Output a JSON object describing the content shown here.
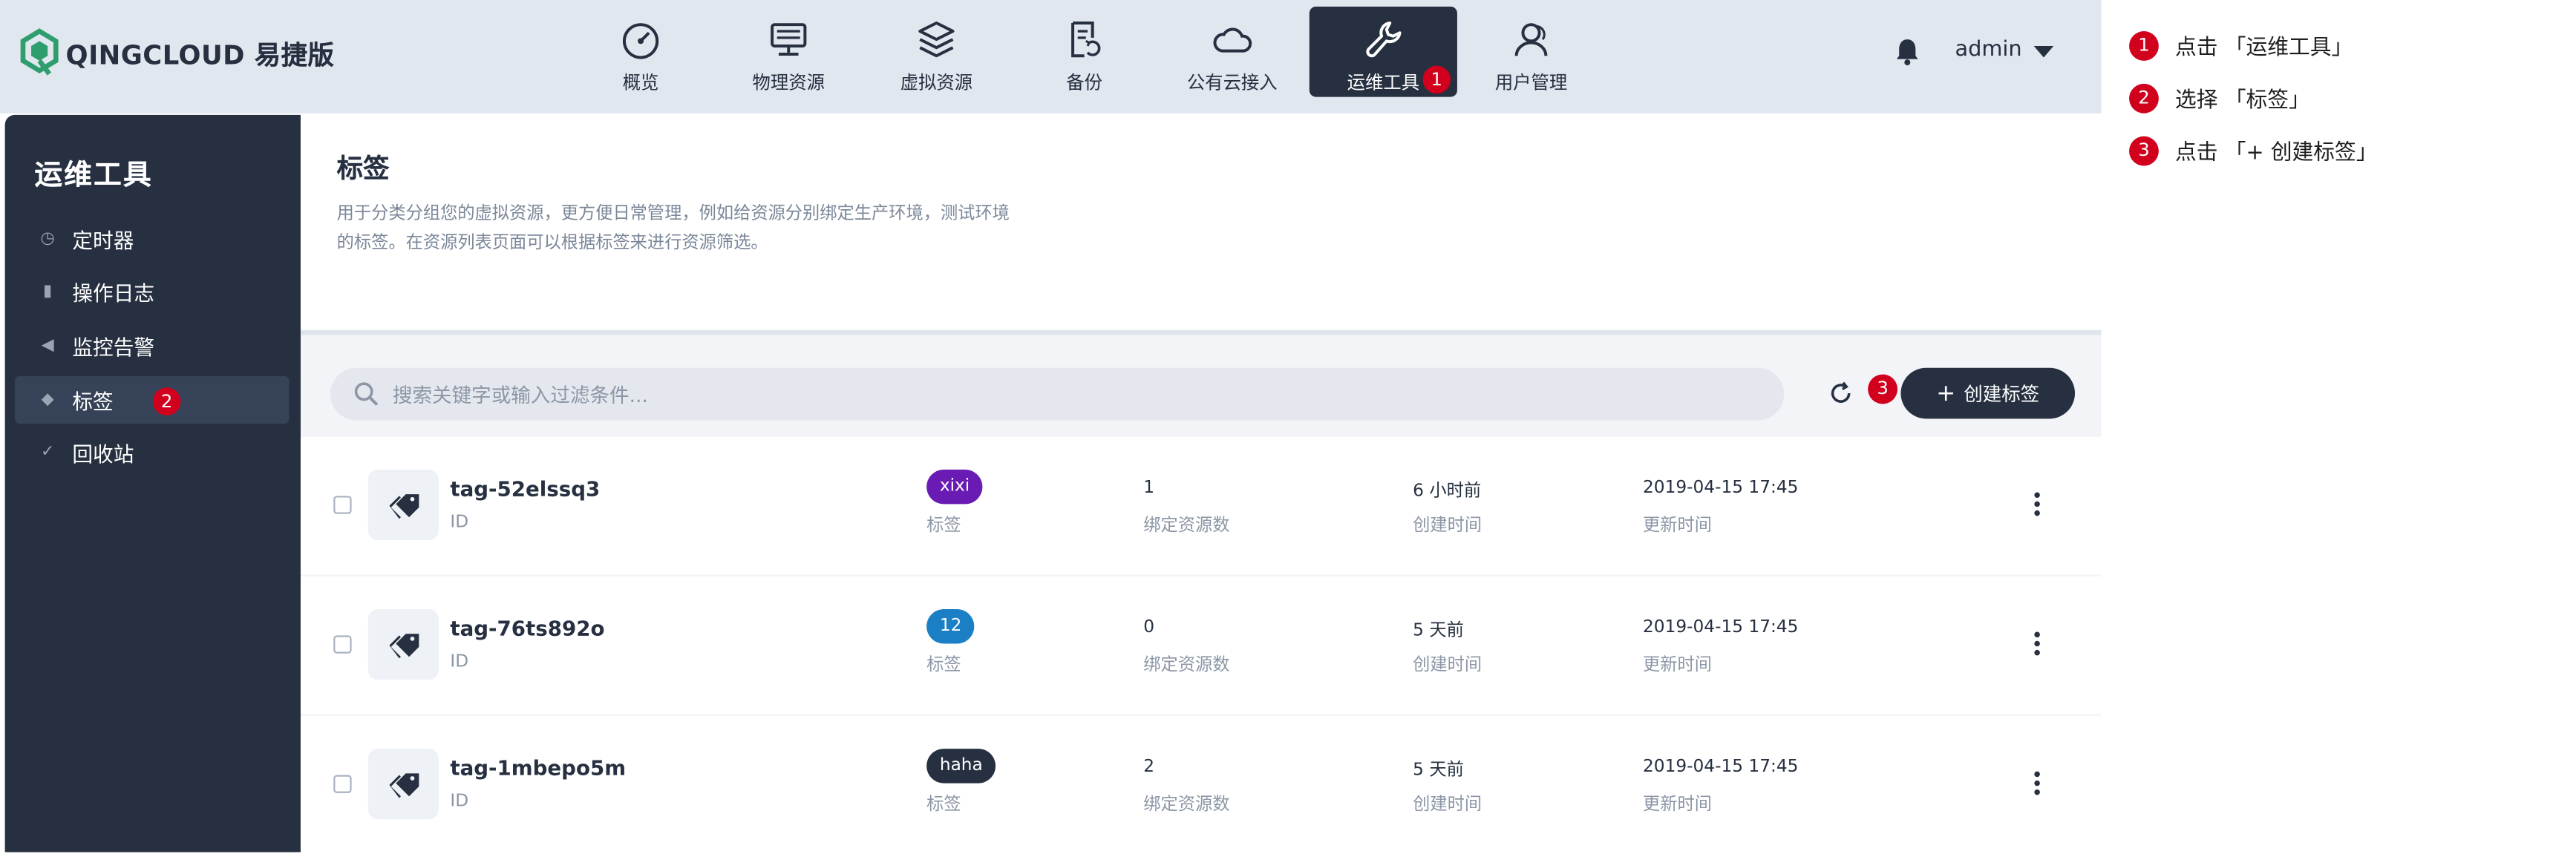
{
  "app": {
    "logo_text": "QINGCLOUD 易捷版",
    "brand_color": "#2f9e6e",
    "accent_dark": "#263040",
    "marker_color": "#d1001c"
  },
  "nav": {
    "items": [
      {
        "label": "概览",
        "icon": "dashboard-gauge-icon"
      },
      {
        "label": "物理资源",
        "icon": "server-icon"
      },
      {
        "label": "虚拟资源",
        "icon": "layers-icon"
      },
      {
        "label": "备份",
        "icon": "backup-document-icon"
      },
      {
        "label": "公有云接入",
        "icon": "cloud-icon"
      },
      {
        "label": "运维工具",
        "icon": "wrench-icon",
        "active": true,
        "marker": "1"
      },
      {
        "label": "用户管理",
        "icon": "users-icon"
      }
    ]
  },
  "user": {
    "name": "admin"
  },
  "sidebar": {
    "title": "运维工具",
    "items": [
      {
        "label": "定时器",
        "icon": "clock-icon"
      },
      {
        "label": "操作日志",
        "icon": "document-icon"
      },
      {
        "label": "监控告警",
        "icon": "megaphone-icon"
      },
      {
        "label": "标签",
        "icon": "tag-icon",
        "active": true,
        "marker": "2"
      },
      {
        "label": "回收站",
        "icon": "broom-icon"
      }
    ]
  },
  "page": {
    "title": "标签",
    "description": "用于分类分组您的虚拟资源，更方便日常管理，例如给资源分别绑定生产环境，测试环境的标签。在资源列表页面可以根据标签来进行资源筛选。"
  },
  "toolbar": {
    "search_placeholder": "搜索关键字或输入过滤条件...",
    "create_label": "创建标签",
    "create_plus": "+",
    "marker": "3"
  },
  "rows": [
    {
      "id": "tag-52elssq3",
      "id_label": "ID",
      "tag": "xixi",
      "tag_color": "#6a1bb3",
      "tag_label": "标签",
      "bound": "1",
      "bound_label": "绑定资源数",
      "created": "6 小时前",
      "created_label": "创建时间",
      "updated": "2019-04-15 17:45",
      "updated_label": "更新时间"
    },
    {
      "id": "tag-76ts892o",
      "id_label": "ID",
      "tag": "12",
      "tag_color": "#1a7fc4",
      "tag_label": "标签",
      "bound": "0",
      "bound_label": "绑定资源数",
      "created": "5 天前",
      "created_label": "创建时间",
      "updated": "2019-04-15 17:45",
      "updated_label": "更新时间"
    },
    {
      "id": "tag-1mbepo5m",
      "id_label": "ID",
      "tag": "haha",
      "tag_color": "#263040",
      "tag_label": "标签",
      "bound": "2",
      "bound_label": "绑定资源数",
      "created": "5 天前",
      "created_label": "创建时间",
      "updated": "2019-04-15 17:45",
      "updated_label": "更新时间"
    }
  ],
  "steps": [
    {
      "num": "1",
      "text": "点击 「运维工具」"
    },
    {
      "num": "2",
      "text": "选择 「标签」"
    },
    {
      "num": "3",
      "text": "点击 「+ 创建标签」"
    }
  ]
}
